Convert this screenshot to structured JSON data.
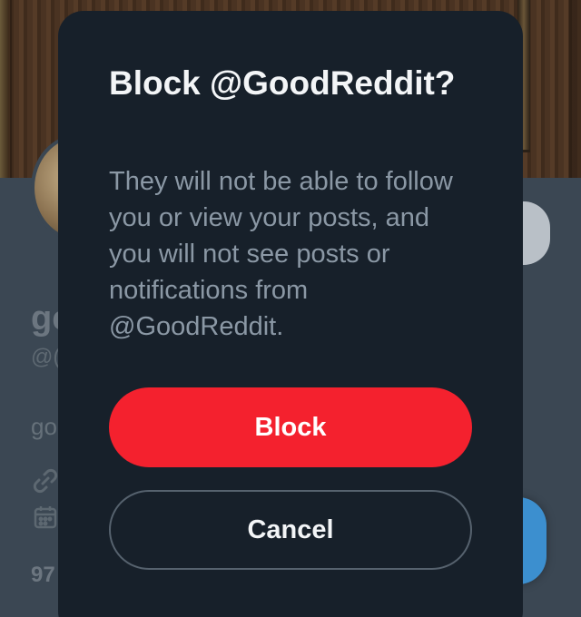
{
  "background": {
    "profile_name_partial": "gc",
    "profile_handle_partial": "@(",
    "bio_partial": "go",
    "count_partial": "97",
    "icons": [
      "link-icon",
      "calendar-icon"
    ]
  },
  "dialog": {
    "title": "Block @GoodReddit?",
    "body": "They will not be able to follow you or view your posts, and you will not see posts or notifications from @GoodReddit.",
    "confirm_label": "Block",
    "cancel_label": "Cancel"
  },
  "colors": {
    "dialog_bg": "#17202a",
    "confirm_bg": "#f4212e",
    "body_text": "#8b98a5",
    "title_text": "#f3f5f7"
  }
}
